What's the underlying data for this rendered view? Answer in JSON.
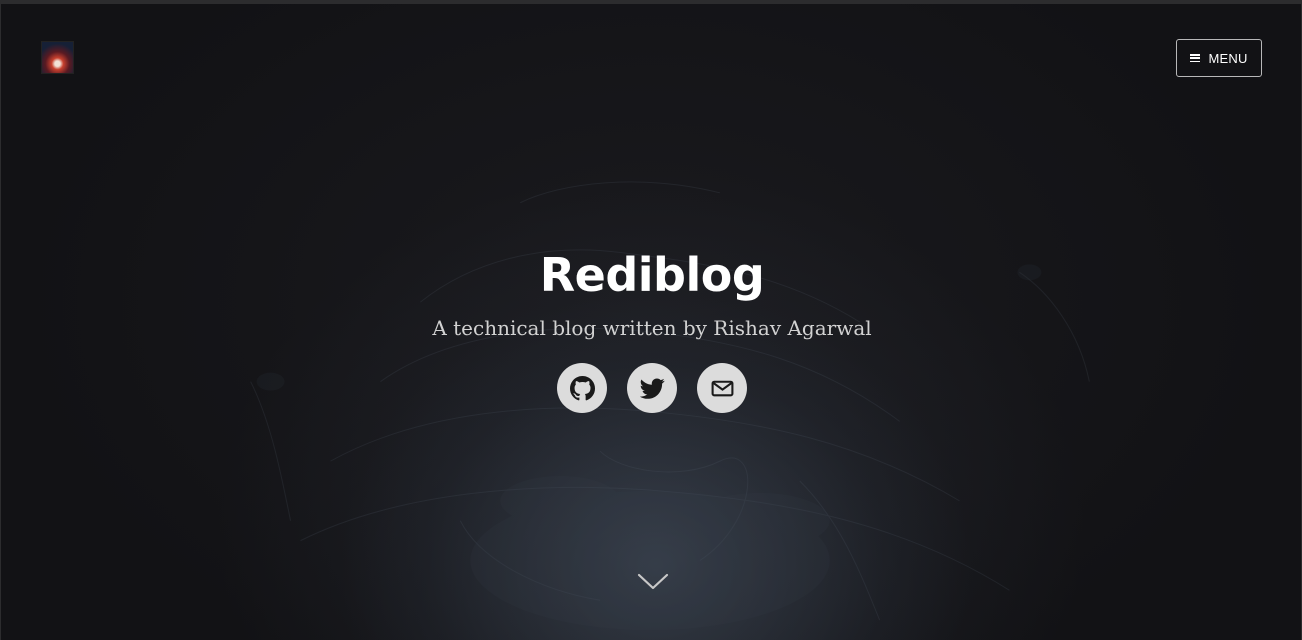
{
  "header": {
    "menu_label": "MENU"
  },
  "hero": {
    "title": "Rediblog",
    "description": "A technical blog written by Rishav Agarwal"
  },
  "social": [
    {
      "icon": "github-icon"
    },
    {
      "icon": "twitter-icon"
    },
    {
      "icon": "mail-icon"
    }
  ],
  "colors": {
    "background": "#121215",
    "title": "#ffffff",
    "description": "#d2d2d2",
    "social_bg": "#dcdcdc",
    "social_icon": "#1a1a1a"
  }
}
